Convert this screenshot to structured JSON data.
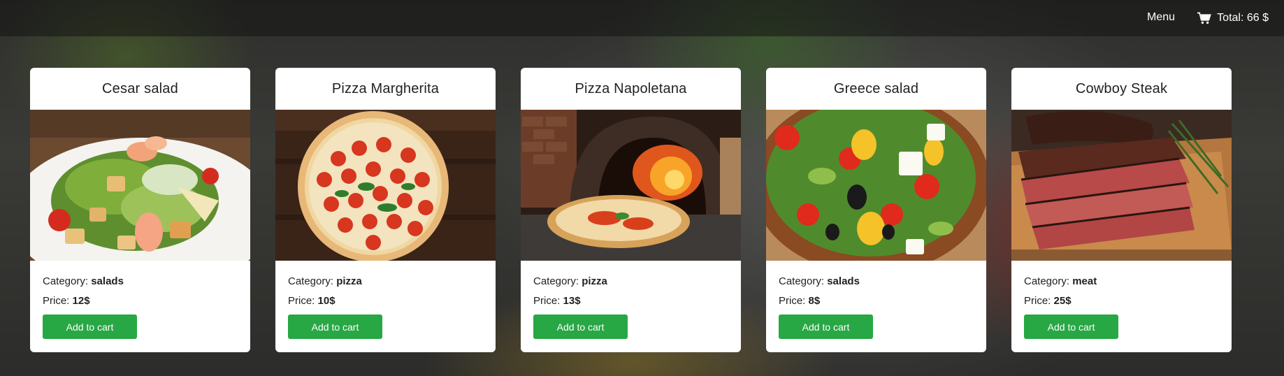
{
  "header": {
    "menu_label": "Menu",
    "cart_label": "Total: 66 $",
    "cart_icon": "shopping-cart-icon"
  },
  "labels": {
    "category_prefix": "Category:",
    "price_prefix": "Price:"
  },
  "products": [
    {
      "name": "Cesar salad",
      "category": "salads",
      "price": "12$",
      "button": "Add to cart",
      "image": "caesar-salad-photo"
    },
    {
      "name": "Pizza Margherita",
      "category": "pizza",
      "price": "10$",
      "button": "Add to cart",
      "image": "pizza-margherita-photo"
    },
    {
      "name": "Pizza Napoletana",
      "category": "pizza",
      "price": "13$",
      "button": "Add to cart",
      "image": "pizza-napoletana-photo"
    },
    {
      "name": "Greece salad",
      "category": "salads",
      "price": "8$",
      "button": "Add to cart",
      "image": "greek-salad-photo"
    },
    {
      "name": "Cowboy Steak",
      "category": "meat",
      "price": "25$",
      "button": "Add to cart",
      "image": "cowboy-steak-photo"
    }
  ],
  "colors": {
    "button": "#28a745",
    "header_bg": "rgba(20,20,20,0.55)"
  }
}
